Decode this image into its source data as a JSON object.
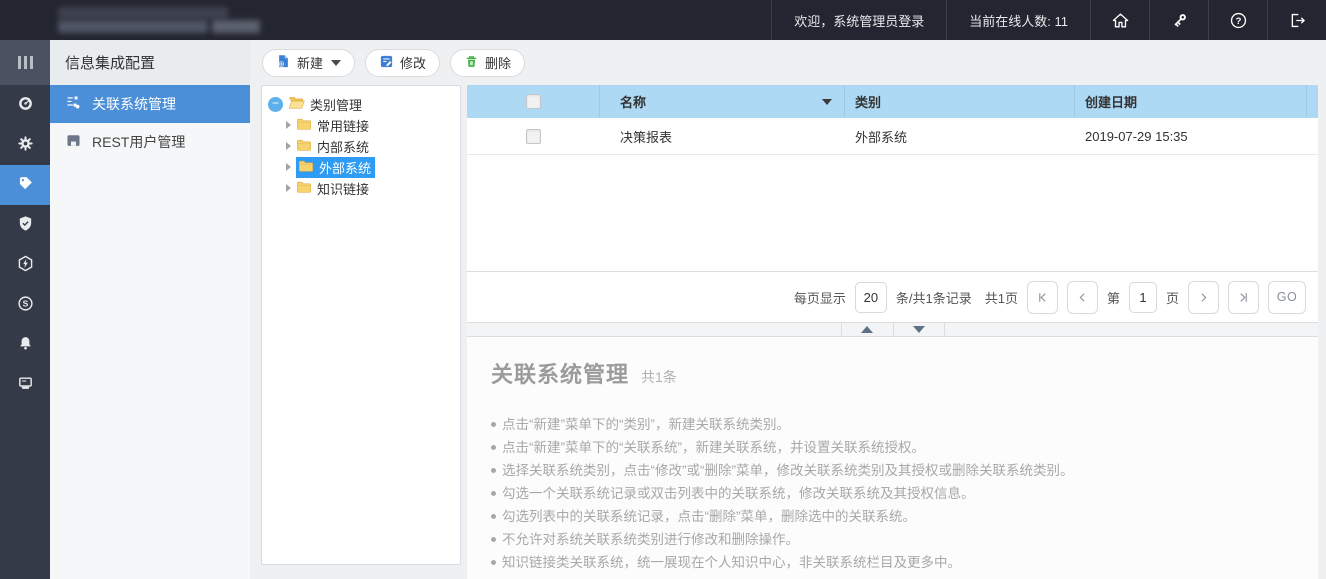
{
  "topbar": {
    "welcome": "欢迎，系统管理员登录",
    "online": "当前在线人数: 11",
    "icons": [
      "home-icon",
      "key-icon",
      "help-icon",
      "logout-icon"
    ]
  },
  "sidebar": {
    "icons": [
      "menu-toggle-icon",
      "dashboard-icon",
      "settings-gear-icon",
      "tag-icon",
      "shield-check-icon",
      "hexagon-bolt-icon",
      "swirl-s-icon",
      "bell-icon",
      "terminal-monitor-icon"
    ],
    "active_index": 3
  },
  "nav": {
    "title": "信息集成配置",
    "items": [
      {
        "label": "关联系统管理",
        "active": true
      },
      {
        "label": "REST用户管理",
        "active": false
      }
    ]
  },
  "toolbar": {
    "new_label": "新建",
    "modify_label": "修改",
    "delete_label": "删除"
  },
  "tree": {
    "root_label": "类别管理",
    "children": [
      {
        "label": "常用链接",
        "selected": false
      },
      {
        "label": "内部系统",
        "selected": false
      },
      {
        "label": "外部系统",
        "selected": true
      },
      {
        "label": "知识链接",
        "selected": false
      }
    ]
  },
  "table": {
    "columns": [
      "名称",
      "类别",
      "创建日期"
    ],
    "rows": [
      {
        "name": "决策报表",
        "category": "外部系统",
        "created": "2019-07-29 15:35"
      }
    ]
  },
  "pagination": {
    "per_page_label": "每页显示",
    "per_page_value": "20",
    "records_label": "条/共1条记录",
    "total_pages_label": "共1页",
    "page_prefix": "第",
    "page_value": "1",
    "page_suffix": "页",
    "go_label": "GO"
  },
  "help": {
    "title": "关联系统管理",
    "count": "共1条",
    "bullets": [
      "点击“新建”菜单下的“类别”，新建关联系统类别。",
      "点击“新建”菜单下的“关联系统”，新建关联系统，并设置关联系统授权。",
      "选择关联系统类别，点击“修改”或“删除”菜单，修改关联系统类别及其授权或删除关联系统类别。",
      "勾选一个关联系统记录或双击列表中的关联系统，修改关联系统及其授权信息。",
      "勾选列表中的关联系统记录，点击“删除”菜单，删除选中的关联系统。",
      "不允许对系统关联系统类别进行修改和删除操作。",
      "知识链接类关联系统，统一展现在个人知识中心，非关联系统栏目及更多中。"
    ]
  },
  "colors": {
    "topbar_bg": "#232530",
    "rail_bg": "#343a47",
    "accent_blue": "#4a8fd8",
    "tree_selection_blue": "#2e9cf4",
    "table_header_blue": "#aed9f4",
    "delete_green": "#3fae3f",
    "help_text_gray": "#a8a8a8"
  }
}
